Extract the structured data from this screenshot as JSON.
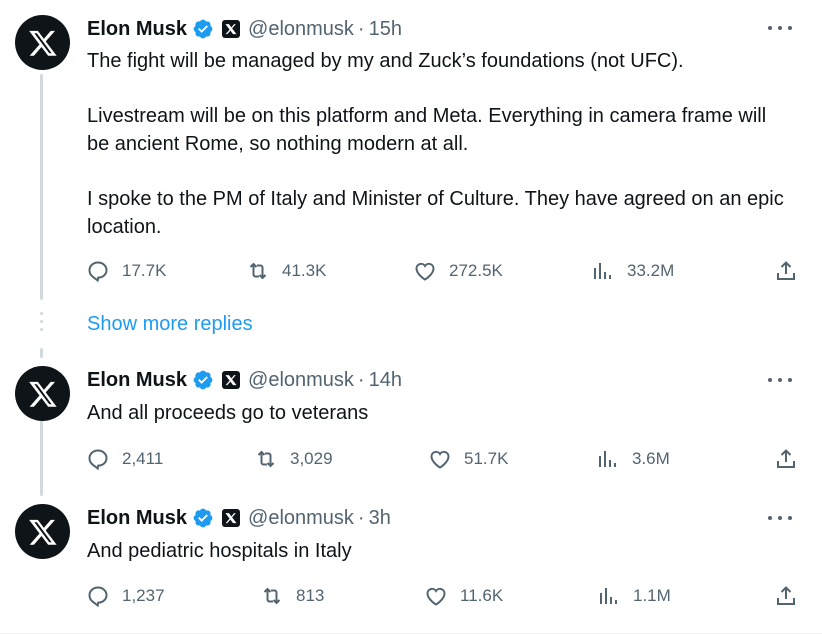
{
  "show_more_replies": "Show more replies",
  "tweets": [
    {
      "name": "Elon Musk",
      "handle": "@elonmusk",
      "separator": "·",
      "time": "15h",
      "text": [
        "The fight will be managed by my and Zuck’s foundations (not UFC).",
        "Livestream will be on this platform and Meta. Everything in camera frame will be ancient Rome, so nothing modern at all.",
        "I spoke to the PM of Italy and Minister of Culture. They have agreed on an epic location."
      ],
      "replies": "17.7K",
      "reposts": "41.3K",
      "likes": "272.5K",
      "views": "33.2M"
    },
    {
      "name": "Elon Musk",
      "handle": "@elonmusk",
      "separator": "·",
      "time": "14h",
      "text": [
        "And all proceeds go to veterans"
      ],
      "replies": "2,411",
      "reposts": "3,029",
      "likes": "51.7K",
      "views": "3.6M"
    },
    {
      "name": "Elon Musk",
      "handle": "@elonmusk",
      "separator": "·",
      "time": "3h",
      "text": [
        "And pediatric hospitals in Italy"
      ],
      "replies": "1,237",
      "reposts": "813",
      "likes": "11.6K",
      "views": "1.1M"
    }
  ],
  "icons": {
    "avatar": "x-logo-icon",
    "verified": "verified-badge-icon",
    "affiliate": "x-affiliate-badge-icon",
    "more": "more-options-icon",
    "reply": "reply-icon",
    "repost": "repost-icon",
    "like": "heart-icon",
    "views": "views-icon",
    "share": "share-icon"
  },
  "colors": {
    "text": "#0f1419",
    "secondary": "#536471",
    "accent": "#1d9bf0",
    "thread_line": "#cfd9de"
  }
}
